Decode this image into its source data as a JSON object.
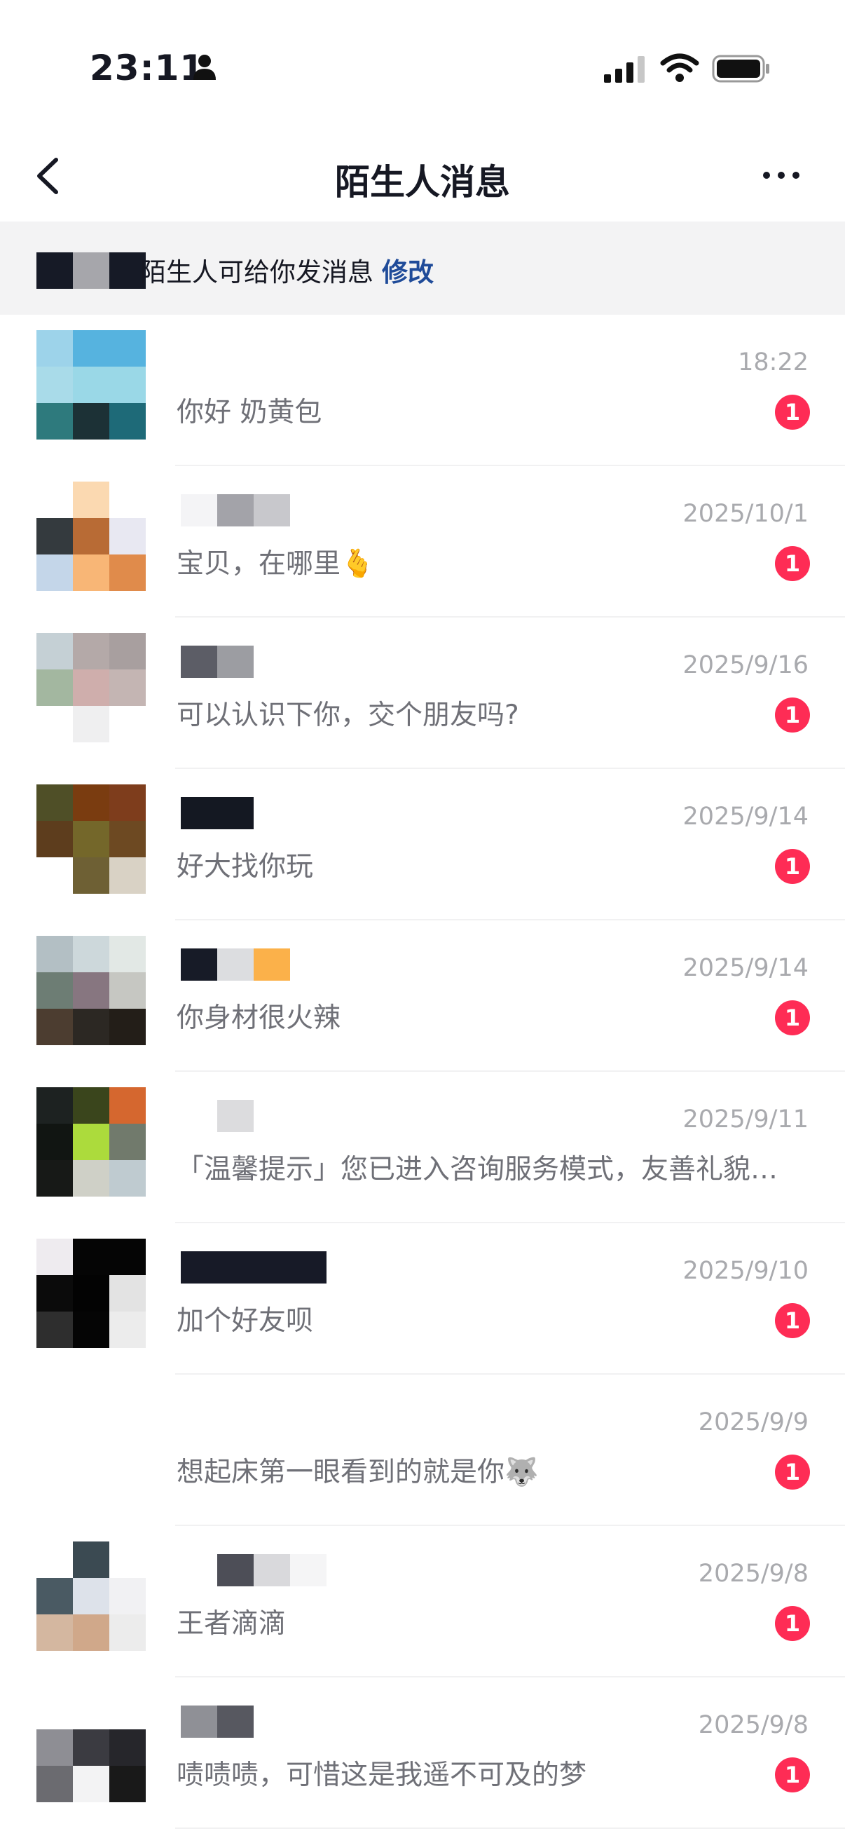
{
  "status": {
    "time": "23:11"
  },
  "nav": {
    "title": "陌生人消息"
  },
  "notice": {
    "text": "陌生人可给你发消息",
    "link": "修改"
  },
  "messages": [
    {
      "time": "18:22",
      "preview": "你好 奶黄包",
      "badge": "1",
      "avatar": [
        "#9dd3ea",
        "#56b3df",
        "#56b3df",
        "#a9dbe9",
        "#9ad8e7",
        "#9ad8e7",
        "#2e7a7d",
        "#1c3136",
        "#1e6a78"
      ],
      "name": []
    },
    {
      "time": "2025/10/1",
      "preview": "宝贝，在哪里🫰",
      "badge": "1",
      "avatar": [
        "#ffffff",
        "#fbd9b1",
        "#ffffff",
        "#343a3e",
        "#b86b35",
        "#e8e8f2",
        "#c4d6e9",
        "#f8b676",
        "#e08b4b"
      ],
      "name": [
        "#f4f4f6",
        "#a3a3a9",
        "#c8c8cc"
      ]
    },
    {
      "time": "2025/9/16",
      "preview": "可以认识下你，交个朋友吗?",
      "badge": "1",
      "avatar": [
        "#c5d0d5",
        "#b4a9a8",
        "#a89f9f",
        "#a3b7a0",
        "#cfaeac",
        "#c4b5b3",
        "#ffffff",
        "#efeff0",
        "#ffffff"
      ],
      "name": [
        "#5c5d66",
        "#9c9da2",
        "#ffffff"
      ]
    },
    {
      "time": "2025/9/14",
      "preview": "好大找你玩",
      "badge": "1",
      "avatar": [
        "#4f4f27",
        "#7a3c10",
        "#7e3d1c",
        "#5d3d1d",
        "#74672a",
        "#6d4922",
        "#ffffff",
        "#6e6034",
        "#d9d2c5"
      ],
      "name": [
        "#141822",
        "#141822"
      ]
    },
    {
      "time": "2025/9/14",
      "preview": "你身材很火辣",
      "badge": "1",
      "avatar": [
        "#b3bfc4",
        "#cdd8db",
        "#e2e8e5",
        "#6d7d74",
        "#877680",
        "#c6c7c2",
        "#4c3d30",
        "#2c2823",
        "#231e18"
      ],
      "name": [
        "#171b27",
        "#dcdde0",
        "#fbb14a"
      ]
    },
    {
      "time": "2025/9/11",
      "preview": "「温馨提示」您已进入咨询服务模式，友善礼貌…",
      "badge": "",
      "avatar": [
        "#1d2221",
        "#3a451c",
        "#d5672f",
        "#111512",
        "#acdb3c",
        "#717a6c",
        "#171917",
        "#cfd0c7",
        "#bfcbd0"
      ],
      "name": [
        "#ffffff",
        "#dcdcde"
      ]
    },
    {
      "time": "2025/9/10",
      "preview": "加个好友呗",
      "badge": "1",
      "avatar": [
        "#eeebef",
        "#050505",
        "#050505",
        "#0b0b0b",
        "#030303",
        "#e3e3e3",
        "#2e2e2e",
        "#050505",
        "#ececec"
      ],
      "name": [
        "#171a27",
        "#171a27",
        "#171a27",
        "#171a27"
      ]
    },
    {
      "time": "2025/9/9",
      "preview": "想起床第一眼看到的就是你🐺",
      "badge": "1",
      "avatar": [
        "#ffffff",
        "#ffffff",
        "#ffffff",
        "#ffffff",
        "#ffffff",
        "#ffffff",
        "#ffffff",
        "#ffffff",
        "#ffffff"
      ],
      "name": []
    },
    {
      "time": "2025/9/8",
      "preview": "王者滴滴",
      "badge": "1",
      "avatar": [
        "#ffffff",
        "#3b4a52",
        "#ffffff",
        "#4a5a63",
        "#dde2ea",
        "#f1f1f3",
        "#d4b7a0",
        "#d0a88a",
        "#ececec"
      ],
      "name": [
        "#ffffff",
        "#4d4e57",
        "#d9d9dc",
        "#f5f5f6"
      ]
    },
    {
      "time": "2025/9/8",
      "preview": "啧啧啧，可惜这是我遥不可及的梦",
      "badge": "1",
      "avatar": [
        "#ffffff",
        "#ffffff",
        "#ffffff",
        "#8e8e94",
        "#3b3b41",
        "#26262b",
        "#6b6b70",
        "#f3f3f4",
        "#191919"
      ],
      "name": [
        "#8f9096",
        "#575860"
      ]
    }
  ]
}
